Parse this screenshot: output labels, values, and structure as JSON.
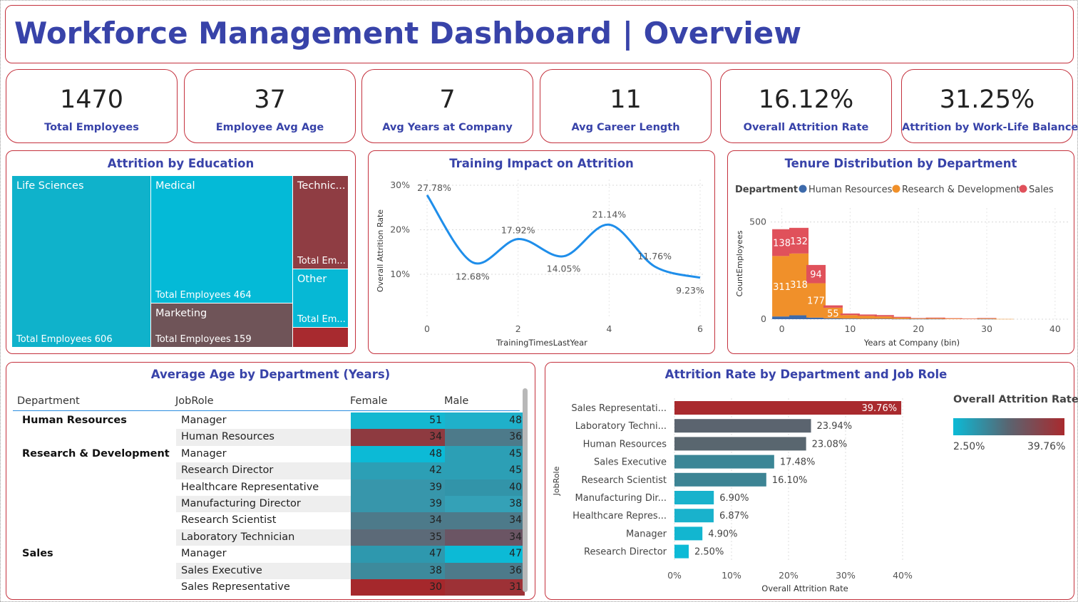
{
  "dashboard": {
    "title": "Workforce Management Dashboard | Overview"
  },
  "colors": {
    "title_blue": "#3843a9",
    "card_border": "#c4313d",
    "gradient_low": "#0bbad6",
    "gradient_mid": "#5a6470",
    "gradient_high": "#a92a2e",
    "hr_blue": "#3d6aab",
    "rd_orange": "#f0902a",
    "sales_red": "#e0515b",
    "line_blue": "#1f8eea"
  },
  "kpis": [
    {
      "value": "1470",
      "label": "Total Employees"
    },
    {
      "value": "37",
      "label": "Employee Avg Age"
    },
    {
      "value": "7",
      "label": "Avg Years at Company"
    },
    {
      "value": "11",
      "label": "Avg Career Length"
    },
    {
      "value": "16.12%",
      "label": "Overall Attrition Rate"
    },
    {
      "value": "31.25%",
      "label": "Attrition by Work-Life Balance"
    }
  ],
  "treemap": {
    "title": "Attrition by Education",
    "cells": [
      {
        "name": "Life Sciences",
        "total": "Total Employees 606"
      },
      {
        "name": "Medical",
        "total": "Total Employees 464"
      },
      {
        "name": "Marketing",
        "total": "Total Employees 159"
      },
      {
        "name": "Technic...",
        "total": "Total Em..."
      },
      {
        "name": "Other",
        "total": "Total Em..."
      },
      {
        "name": "",
        "total": ""
      }
    ]
  },
  "training_chart": {
    "panel_title": "Training Impact on Attrition",
    "chart_data": {
      "type": "line",
      "xlabel": "TrainingTimesLastYear",
      "ylabel": "Overall Attrition Rate",
      "x": [
        0,
        1,
        2,
        3,
        4,
        5,
        6
      ],
      "values": [
        27.78,
        12.68,
        17.92,
        14.05,
        21.14,
        11.76,
        9.23
      ],
      "data_labels": [
        "27.78%",
        "12.68%",
        "17.92%",
        "14.05%",
        "21.14%",
        "11.76%",
        "9.23%"
      ],
      "x_ticks": [
        "0",
        "2",
        "4",
        "6"
      ],
      "y_ticks": [
        "10%",
        "20%",
        "30%"
      ],
      "y_tick_values": [
        10,
        20,
        30
      ],
      "ylim": [
        6,
        30
      ],
      "grid": true
    }
  },
  "tenure_chart": {
    "panel_title": "Tenure Distribution by Department",
    "legend_title": "Department",
    "chart_data": {
      "type": "bar",
      "stacked": true,
      "xlabel": "Years at Company (bin)",
      "ylabel": "CountEmployees",
      "x_bins": [
        0,
        2.5,
        5,
        7.5,
        10,
        12.5,
        15,
        17.5,
        20,
        22.5,
        25,
        27.5,
        30,
        32.5
      ],
      "series": [
        {
          "name": "Human Resources",
          "values": [
            14,
            20,
            8,
            4,
            3,
            2,
            2,
            1,
            1,
            1,
            0,
            0,
            1,
            0
          ]
        },
        {
          "name": "Research & Development",
          "values": [
            311,
            318,
            177,
            55,
            18,
            15,
            12,
            7,
            3,
            4,
            3,
            2,
            3,
            1
          ]
        },
        {
          "name": "Sales",
          "values": [
            138,
            132,
            94,
            12,
            8,
            7,
            7,
            4,
            2,
            3,
            2,
            1,
            2,
            0
          ]
        }
      ],
      "data_labels": [
        [
          "",
          "",
          ""
        ],
        [
          "",
          "",
          ""
        ]
      ],
      "labels": {
        "b0_rd": "311",
        "b0_s": "138",
        "b1_rd": "318",
        "b1_s": "132",
        "b2_rd": "177",
        "b2_s": "94",
        "b3_rd": "55"
      },
      "x_ticks": [
        "0",
        "10",
        "20",
        "30",
        "40"
      ],
      "y_ticks": [
        "0",
        "500"
      ],
      "ylim": [
        0,
        550
      ],
      "xlim": [
        -1,
        42
      ],
      "legend_position": "top-left",
      "grid": true
    }
  },
  "age_matrix": {
    "title": "Average Age by Department (Years)",
    "headers": {
      "department": "Department",
      "jobrole": "JobRole",
      "female": "Female",
      "male": "Male"
    },
    "rows": [
      {
        "dept": "Human Resources",
        "role": "Manager",
        "female": "51",
        "male": "48"
      },
      {
        "dept": "",
        "role": "Human Resources",
        "female": "34",
        "male": "36"
      },
      {
        "dept": "Research & Development",
        "role": "Manager",
        "female": "48",
        "male": "45"
      },
      {
        "dept": "",
        "role": "Research Director",
        "female": "42",
        "male": "45"
      },
      {
        "dept": "",
        "role": "Healthcare Representative",
        "female": "39",
        "male": "40"
      },
      {
        "dept": "",
        "role": "Manufacturing Director",
        "female": "39",
        "male": "38"
      },
      {
        "dept": "",
        "role": "Research Scientist",
        "female": "34",
        "male": "34"
      },
      {
        "dept": "",
        "role": "Laboratory Technician",
        "female": "35",
        "male": "34"
      },
      {
        "dept": "Sales",
        "role": "Manager",
        "female": "47",
        "male": "47"
      },
      {
        "dept": "",
        "role": "Sales Executive",
        "female": "38",
        "male": "36"
      },
      {
        "dept": "",
        "role": "Sales Representative",
        "female": "30",
        "male": "31"
      }
    ],
    "cell_colors": [
      [
        "#14b8d1",
        "#1fb0ca"
      ],
      [
        "#8e3a40",
        "#4d7a8a"
      ],
      [
        "#0cbad6",
        "#2c9fb5"
      ],
      [
        "#2c9fb5",
        "#2c9fb5"
      ],
      [
        "#3796ab",
        "#3294a9"
      ],
      [
        "#3796ab",
        "#34a1b7"
      ],
      [
        "#4d7a8a",
        "#4d7a8a"
      ],
      [
        "#5c6a78",
        "#6b5564"
      ],
      [
        "#2e98ae",
        "#0cbad6"
      ],
      [
        "#3d8a9c",
        "#4d7a8a"
      ],
      [
        "#a5282c",
        "#9d3136"
      ]
    ]
  },
  "attrition_chart": {
    "title": "Attrition Rate by Department and Job Role",
    "legend_title": "Overall Attrition Rate",
    "legend_min": "2.50%",
    "legend_max": "39.76%",
    "chart_data": {
      "type": "bar",
      "orientation": "horizontal",
      "xlabel": "Overall Attrition Rate",
      "ylabel": "JobRole",
      "categories": [
        "Sales Representati...",
        "Laboratory Techni...",
        "Human Resources",
        "Sales Executive",
        "Research Scientist",
        "Manufacturing Dir...",
        "Healthcare Repres...",
        "Manager",
        "Research Director"
      ],
      "values": [
        39.76,
        23.94,
        23.08,
        17.48,
        16.1,
        6.9,
        6.87,
        4.9,
        2.5
      ],
      "data_labels": [
        "39.76%",
        "23.94%",
        "23.08%",
        "17.48%",
        "16.10%",
        "6.90%",
        "6.87%",
        "4.90%",
        "2.50%"
      ],
      "x_ticks": [
        "0%",
        "10%",
        "20%",
        "30%",
        "40%"
      ],
      "x_tick_values": [
        0,
        10,
        20,
        30,
        40
      ],
      "xlim": [
        0,
        40
      ],
      "bar_colors": [
        "#a92a2e",
        "#5b646f",
        "#59666f",
        "#3b8696",
        "#3d8494",
        "#19b2cc",
        "#19b2cc",
        "#12b6d0",
        "#0dbad6"
      ]
    }
  }
}
